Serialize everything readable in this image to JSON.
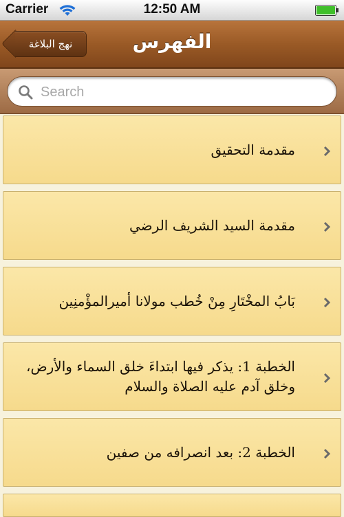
{
  "status_bar": {
    "carrier": "Carrier",
    "time": "12:50 AM",
    "wifi_icon": "wifi-icon",
    "battery_icon": "battery-icon"
  },
  "nav_bar": {
    "title": "الفهرس",
    "back_label": "نهج البلاغة"
  },
  "search": {
    "placeholder": "Search",
    "value": ""
  },
  "list": {
    "items": [
      {
        "label": "مقدمة التحقيق"
      },
      {
        "label": "مقدمة السيد الشريف الرضي"
      },
      {
        "label": "بَابُ المخْتَارِ مِنْ خُطب مولانا أميرالمؤْمنِين"
      },
      {
        "label": "الخطبة 1: يذكر فيها ابتداءَ خلق السماء والأرض، وخلق آدم عليه الصلاة والسلام"
      },
      {
        "label": "الخطبة 2: بعد انصرافه من صفين"
      },
      {
        "label": ""
      }
    ]
  },
  "colors": {
    "nav_brown": "#9a5a26",
    "row_fill": "#f6da8c",
    "row_border": "#c9b170"
  }
}
